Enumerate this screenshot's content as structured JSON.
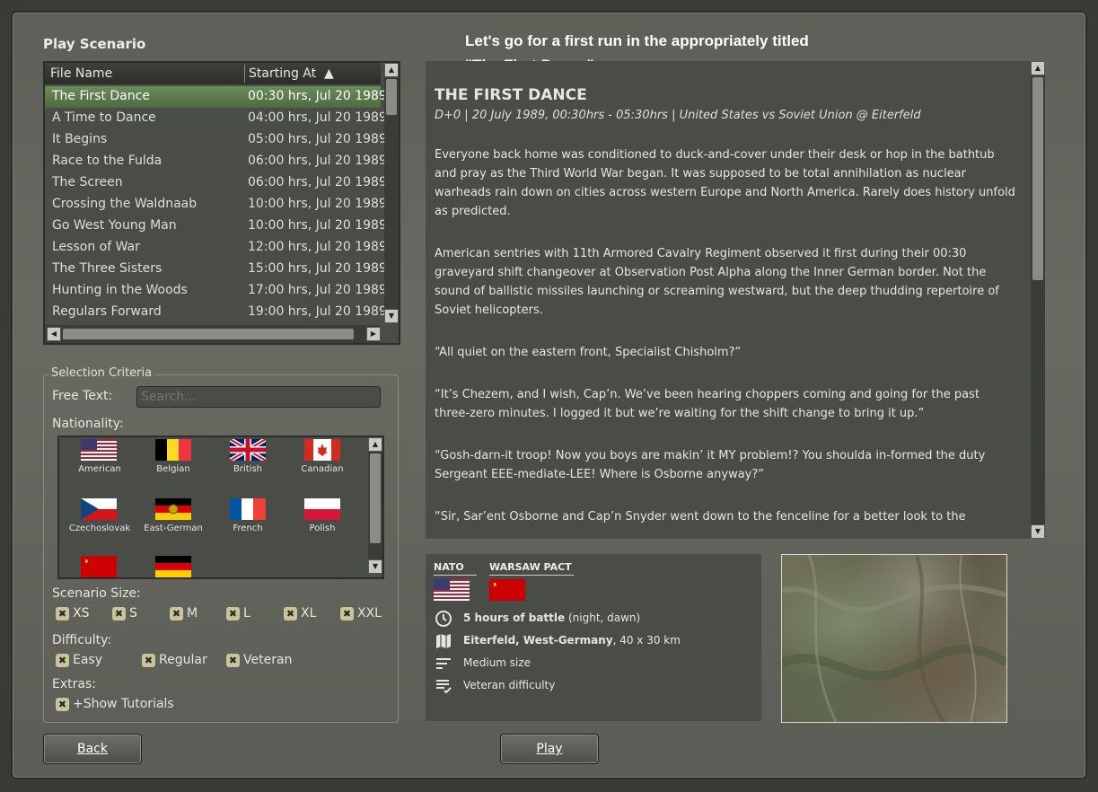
{
  "page_title": "Play Scenario",
  "caption_line1": "Let's go for a first run in the appropriately titled",
  "caption_line2": "\"The First Dance\"",
  "list": {
    "col_file": "File Name",
    "col_start": "Starting At",
    "sort_glyph": "▲",
    "rows": [
      {
        "name": "The First Dance",
        "time": "00:30 hrs, Jul 20 1989"
      },
      {
        "name": "A Time to Dance",
        "time": "04:00 hrs, Jul 20 1989"
      },
      {
        "name": "It Begins",
        "time": "05:00 hrs, Jul 20 1989"
      },
      {
        "name": "Race to the Fulda",
        "time": "06:00 hrs, Jul 20 1989"
      },
      {
        "name": "The Screen",
        "time": "06:00 hrs, Jul 20 1989"
      },
      {
        "name": "Crossing the Waldnaab",
        "time": "10:00 hrs, Jul 20 1989"
      },
      {
        "name": "Go West Young Man",
        "time": "10:00 hrs, Jul 20 1989"
      },
      {
        "name": "Lesson of War",
        "time": "12:00 hrs, Jul 20 1989"
      },
      {
        "name": "The Three Sisters",
        "time": "15:00 hrs, Jul 20 1989"
      },
      {
        "name": "Hunting in the Woods",
        "time": "17:00 hrs, Jul 20 1989"
      },
      {
        "name": "Regulars Forward",
        "time": "19:00 hrs, Jul 20 1989"
      }
    ]
  },
  "criteria": {
    "legend": "Selection Criteria",
    "free_text_label": "Free Text:",
    "search_placeholder": "Search...",
    "nationality_label": "Nationality:",
    "nations": [
      "American",
      "Belgian",
      "British",
      "Canadian",
      "Czechoslovak",
      "East-German",
      "French",
      "Polish"
    ],
    "size_label": "Scenario Size:",
    "sizes": [
      "XS",
      "S",
      "M",
      "L",
      "XL",
      "XXL"
    ],
    "difficulty_label": "Difficulty:",
    "difficulties": [
      "Easy",
      "Regular",
      "Veteran"
    ],
    "extras_label": "Extras:",
    "extras": [
      "+Show Tutorials"
    ],
    "check_glyph": "✖"
  },
  "description": {
    "heading": "THE FIRST DANCE",
    "subheading": "D+0 | 20 July 1989, 00:30hrs - 05:30hrs | United States vs Soviet Union @ Eiterfeld",
    "paragraphs": [
      "Everyone back home was conditioned to duck-and-cover under their desk or hop in the bathtub and pray as the Third World War began. It was supposed to be total annihilation as nuclear warheads rain down on cities across western Europe and North America. Rarely does history unfold as predicted.",
      "American sentries with 11th Armored Cavalry Regiment observed it first during their 00:30 graveyard shift changeover at Observation Post Alpha along the Inner German border. Not the sound of ballistic missiles launching or screaming westward, but the deep thudding repertoire of Soviet helicopters.",
      "“All quiet on the eastern front, Specialist Chisholm?”",
      "“It’s Chezem, and I wish, Cap’n. We’ve been hearing choppers coming and going for the past three-zero minutes. I logged it but we’re waiting for the shift change to bring it up.”",
      "“Gosh-darn-it troop! Now you boys are makin’ it MY problem!? You shoulda in-formed the duty Sergeant EEE-mediate-LEE! Where is Osborne anyway?”",
      "“Sir, Sar’ent Osborne and Cap’n Snyder went down to the fenceline for a better look to the"
    ]
  },
  "info": {
    "side_a": "NATO",
    "side_b": "WARSAW PACT",
    "duration_bold": "5 hours of battle",
    "duration_rest": " (night, dawn)",
    "location_bold": "Eiterfeld, West-Germany",
    "location_rest": ", 40 x 30 km",
    "size": "Medium size",
    "difficulty": "Veteran difficulty"
  },
  "buttons": {
    "back": "Back",
    "play": "Play"
  }
}
